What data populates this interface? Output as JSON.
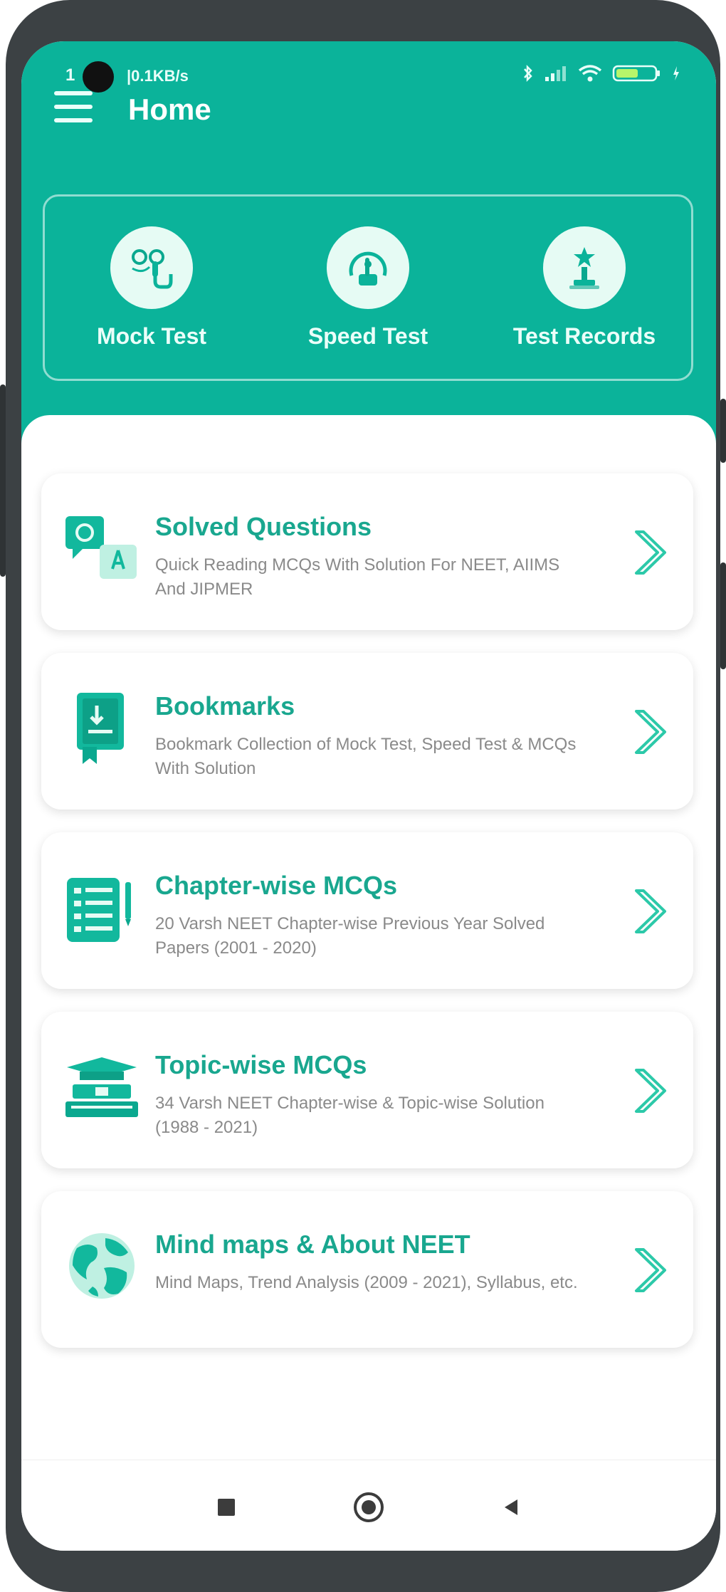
{
  "statusbar": {
    "time": "1",
    "speed": "|0.1KB/s",
    "icons": [
      "bluetooth-icon",
      "signal-icon",
      "wifi-icon",
      "battery-icon"
    ]
  },
  "appbar": {
    "title": "Home",
    "menu_icon": "hamburger-menu-icon"
  },
  "quick_actions": [
    {
      "label": "Mock Test",
      "icon": "mock-test-icon"
    },
    {
      "label": "Speed Test",
      "icon": "speed-test-icon"
    },
    {
      "label": "Test Records",
      "icon": "test-records-icon"
    }
  ],
  "cards": [
    {
      "title": "Solved Questions",
      "desc": "Quick Reading MCQs With Solution For NEET, AIIMS And JIPMER",
      "icon": "solved-questions-icon"
    },
    {
      "title": "Bookmarks",
      "desc": "Bookmark Collection of Mock Test, Speed Test & MCQs With Solution",
      "icon": "bookmark-icon"
    },
    {
      "title": "Chapter-wise MCQs",
      "desc": "20 Varsh NEET Chapter-wise Previous Year Solved Papers (2001 - 2020)",
      "icon": "chapter-list-icon"
    },
    {
      "title": "Topic-wise MCQs",
      "desc": "34 Varsh NEET Chapter-wise & Topic-wise Solution (1988 - 2021)",
      "icon": "graduation-books-icon"
    },
    {
      "title": "Mind maps & About NEET",
      "desc": "Mind Maps, Trend Analysis (2009 - 2021), Syllabus, etc.",
      "icon": "globe-icon"
    }
  ],
  "navbar": {
    "icons": [
      "recents-square-icon",
      "home-circle-icon",
      "back-triangle-icon"
    ]
  },
  "colors": {
    "primary": "#0bb39a",
    "title_text": "#19a78f",
    "desc_text": "#8a8a8a",
    "icon_light": "#e6fbf4"
  }
}
